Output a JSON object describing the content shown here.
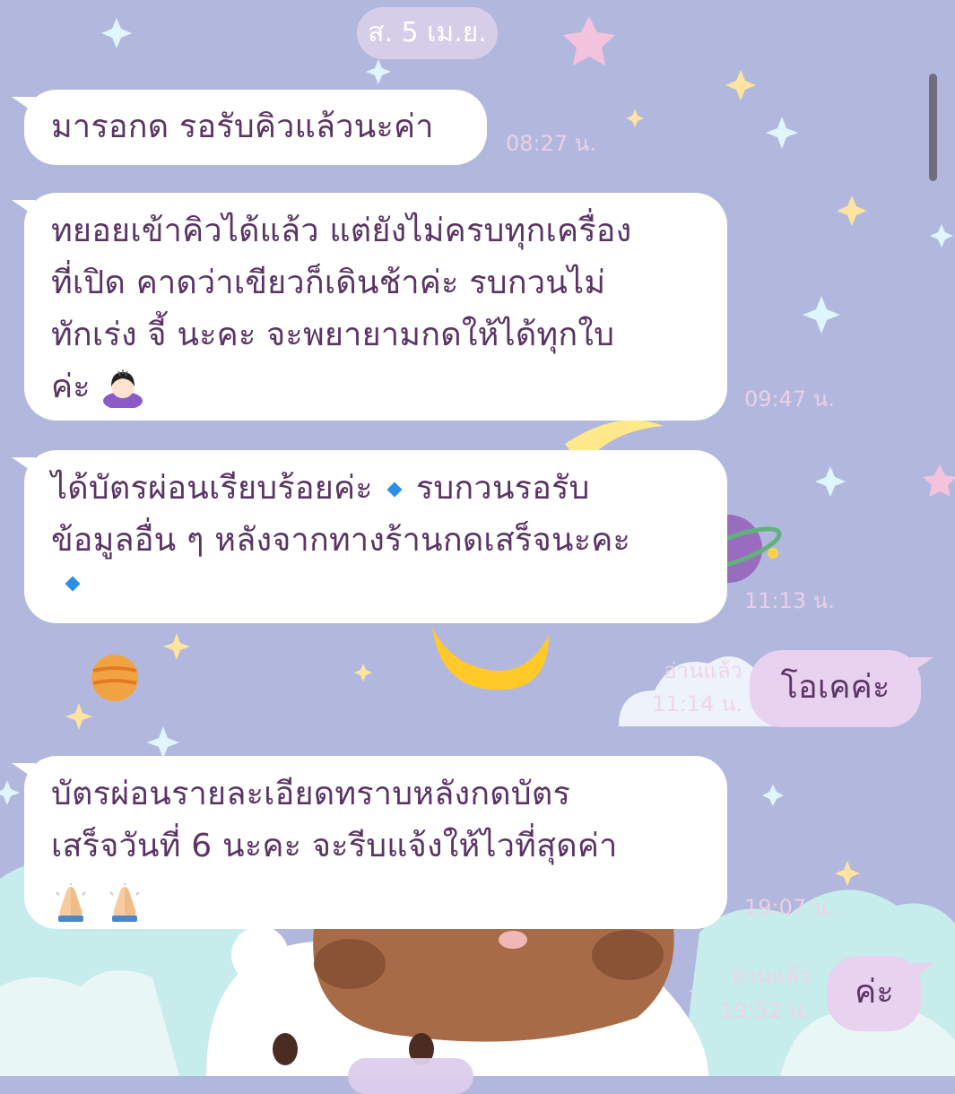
{
  "chat": {
    "date": "ส. 5 เม.ย.",
    "messages": [
      {
        "side": "in",
        "lines": [
          "มารอกด รอรับคิวแล้วนะค่า"
        ],
        "time": "08:27 น."
      },
      {
        "side": "in",
        "lines": [
          "ทยอยเข้าคิวได้แล้ว แต่ยังไม่ครบทุกเครื่อง",
          "ที่เปิด คาดว่าเขียวก็เดินช้าค่ะ รบกวนไม่",
          "ทักเร่ง จี้ นะคะ จะพยายามกดให้ได้ทุกใบ",
          "ค่ะ"
        ],
        "emoji": "woman-bowing-icon",
        "time": "09:47 น."
      },
      {
        "side": "in",
        "lines": [
          "ได้บัตรผ่อนเรียบร้อยค่ะ",
          "รบกวนรอรับ",
          "ข้อมูลอื่น ๆ หลังจากทางร้านกดเสร็จนะคะ"
        ],
        "emoji": "small-blue-diamond-icon",
        "time": "11:13 น."
      },
      {
        "side": "out",
        "lines": [
          "โอเคค่ะ"
        ],
        "read": "อ่านแล้ว",
        "time": "11:14 น."
      },
      {
        "side": "in",
        "lines": [
          "บัตรผ่อนรายละเอียดทราบหลังกดบัตร",
          "เสร็จวันที่ 6 นะคะ จะรีบแจ้งให้ไวที่สุดค่า"
        ],
        "emoji": "folded-hands-icon",
        "time": "19:07 น."
      },
      {
        "side": "out",
        "lines": [
          "ค่ะ"
        ],
        "read": "อ่านแล้ว",
        "time": "19:52 น."
      }
    ]
  },
  "colors": {
    "wallpaper": "#b2b8dd",
    "incoming_bubble": "#ffffff",
    "outgoing_bubble": "#e8d2ef",
    "message_text": "#5a3464",
    "timestamp": "#f0d2e6"
  }
}
